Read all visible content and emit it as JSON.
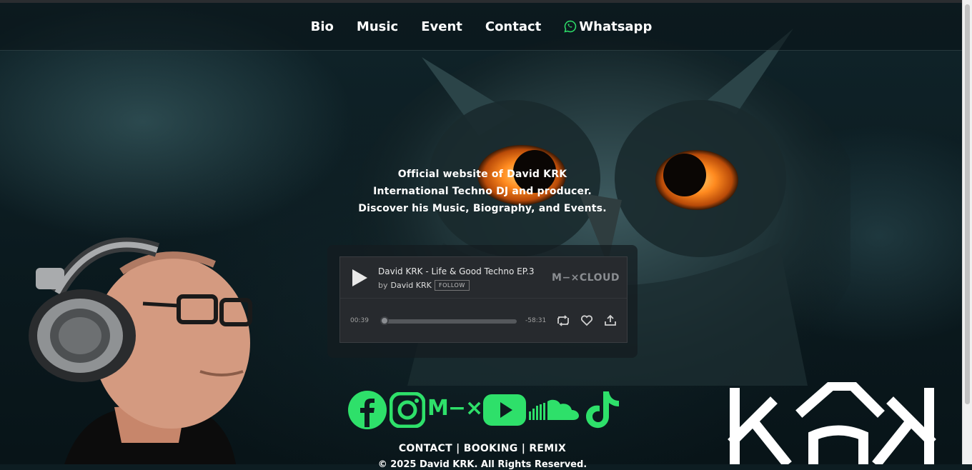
{
  "nav": {
    "items": [
      {
        "label": "Bio"
      },
      {
        "label": "Music"
      },
      {
        "label": "Event"
      },
      {
        "label": "Contact"
      },
      {
        "label": "Whatsapp"
      }
    ]
  },
  "intro": {
    "line1": "Official website of David KRK",
    "line2": "International Techno DJ and producer.",
    "line3": "Discover his Music, Biography, and Events."
  },
  "player": {
    "title": "David KRK - Life & Good Techno EP.3",
    "by_label": "by",
    "artist": "David KRK",
    "follow_label": "FOLLOW",
    "brand": "M−×CLOUD",
    "elapsed": "00:39",
    "remaining": "-58:31",
    "progress": 0.01
  },
  "socials": {
    "icons": [
      "facebook-icon",
      "instagram-icon",
      "mixcloud-icon",
      "youtube-icon",
      "soundcloud-icon",
      "tiktok-icon"
    ],
    "accent": "#2ee06a",
    "mixcloud_text": "M−×"
  },
  "footer": {
    "links": "CONTACT | BOOKING | REMIX",
    "copyright": "© 2025 David KRK. All Rights Reserved."
  },
  "colors": {
    "nav_text": "#ffffff",
    "owl_eye": "#ff8a1f",
    "player_bg": "#272a2e"
  }
}
